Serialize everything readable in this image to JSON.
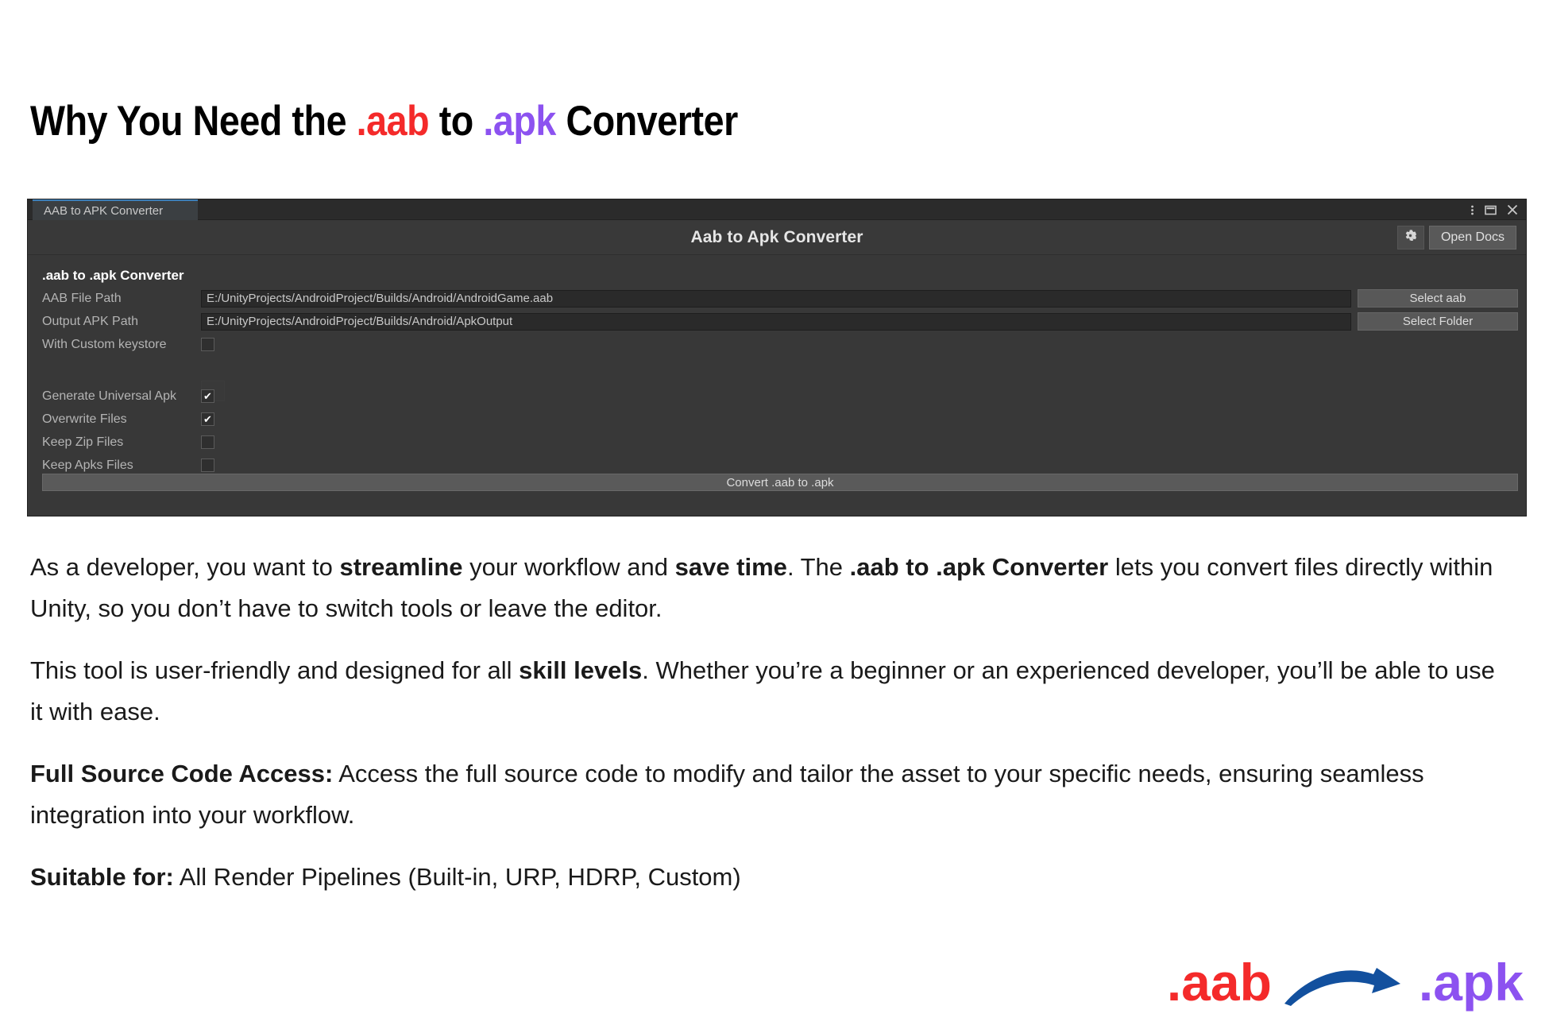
{
  "heading": {
    "part1": "Why You Need the ",
    "aab": ".aab",
    "part2": " to ",
    "apk": ".apk",
    "part3": " Converter"
  },
  "colors": {
    "aab_red": "#F42A2A",
    "apk_purple": "#8C52F0",
    "arrow_blue": "#12509E",
    "tab_accent": "#3D7FB8",
    "window_bg": "#383838"
  },
  "unity_window": {
    "tab_label": "AAB to APK Converter",
    "window_controls": {
      "menu": "kebab-menu-icon",
      "maximize": "maximize-icon",
      "close": "close-icon"
    },
    "toolbar": {
      "title": "Aab to Apk Converter",
      "gear_icon": "gear-icon",
      "open_docs_label": "Open Docs"
    },
    "section_header": ".aab to .apk Converter",
    "fields": [
      {
        "label": "AAB File Path",
        "value": "E:/UnityProjects/AndroidProject/Builds/Android/AndroidGame.aab",
        "button": "Select aab"
      },
      {
        "label": "Output APK Path",
        "value": "E:/UnityProjects/AndroidProject/Builds/Android/ApkOutput",
        "button": "Select Folder"
      }
    ],
    "keystore_toggle": {
      "label": "With Custom keystore",
      "checked": false
    },
    "options": [
      {
        "label": "Generate Universal Apk",
        "checked": true
      },
      {
        "label": "Overwrite Files",
        "checked": true
      },
      {
        "label": "Keep Zip Files",
        "checked": false
      },
      {
        "label": "Keep Apks Files",
        "checked": false
      }
    ],
    "convert_button": "Convert .aab to .apk"
  },
  "body": {
    "p1_a": "As a developer, you want to ",
    "p1_b": "streamline",
    "p1_c": " your workflow and ",
    "p1_d": "save time",
    "p1_e": ". The ",
    "p1_f": ".aab to .apk Converter",
    "p1_g": " lets you convert files directly within Unity, so you don’t have to switch tools or leave the editor.",
    "p2_a": "This tool is user-friendly and designed for all ",
    "p2_b": "skill levels",
    "p2_c": ". Whether you’re a beginner or an experienced developer, you’ll be able to use it with ease.",
    "p3_a": "Full Source Code Access:",
    "p3_b": " Access the full source code to modify and tailor the asset to your specific needs, ensuring seamless integration into your workflow.",
    "p4_a": "Suitable for:",
    "p4_b": " All Render Pipelines (Built-in, URP, HDRP, Custom)"
  },
  "footer": {
    "aab": ".aab",
    "arrow": "curved-arrow-icon",
    "apk": ".apk"
  }
}
